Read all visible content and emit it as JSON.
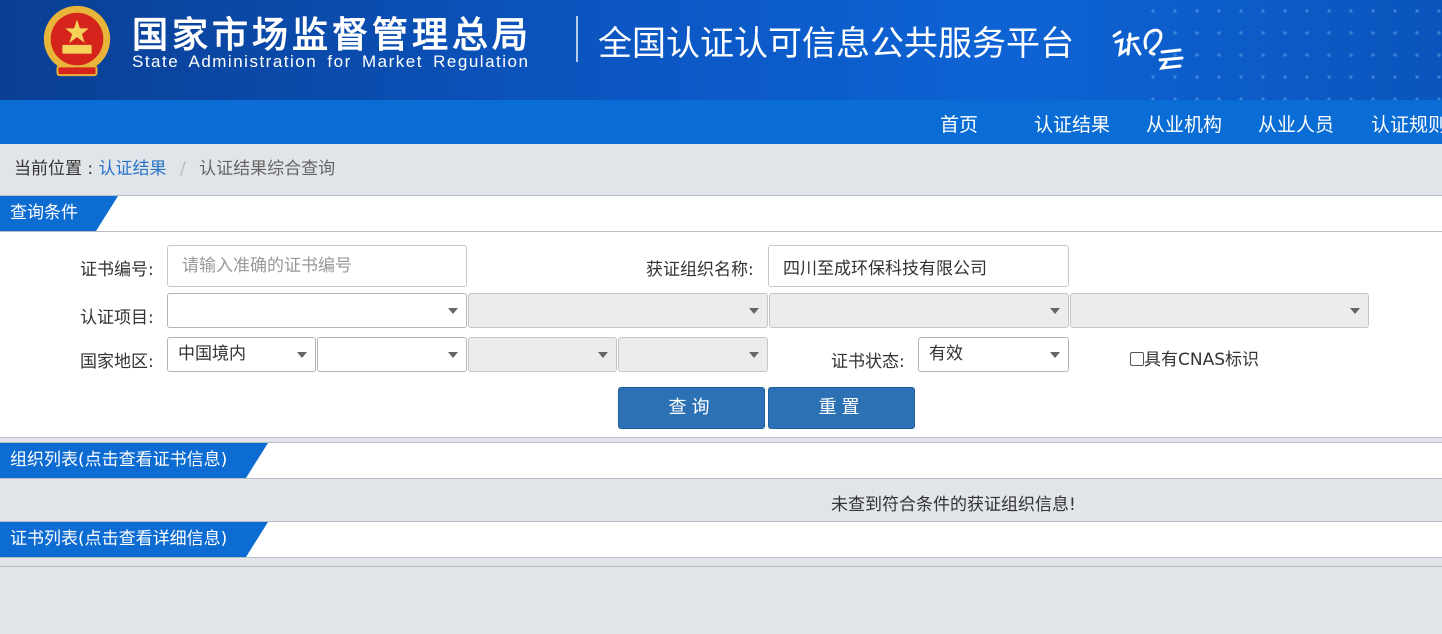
{
  "header": {
    "agency_cn": "国家市场监督管理总局",
    "agency_en": "State Administration  for  Market Regulation",
    "platform_title": "全国认证认可信息公共服务平台",
    "logo_icon": "renzheng-yun-logo",
    "emblem_icon": "national-emblem-icon"
  },
  "nav": {
    "items": [
      "首页",
      "认证结果",
      "从业机构",
      "从业人员",
      "认证规则"
    ]
  },
  "breadcrumb": {
    "prefix": "当前位置 :",
    "link": "认证结果",
    "separator": "/",
    "current": "认证结果综合查询"
  },
  "query_panel": {
    "title": "查询条件",
    "cert_no_label": "证书编号:",
    "cert_no_placeholder": "请输入准确的证书编号",
    "cert_no_value": "",
    "org_name_label": "获证组织名称:",
    "org_name_value": "四川至成环保科技有限公司",
    "project_label": "认证项目:",
    "project_selects": [
      "",
      "",
      "",
      ""
    ],
    "region_label": "国家地区:",
    "region_selects": [
      "中国境内",
      "",
      "",
      ""
    ],
    "status_label": "证书状态:",
    "status_value": "有效",
    "cnas_label": "具有CNAS标识",
    "cnas_checked": false,
    "search_button": "查询",
    "reset_button": "重置"
  },
  "org_panel": {
    "title": "组织列表(点击查看证书信息)",
    "empty_message": "未查到符合条件的获证组织信息!"
  },
  "cert_panel": {
    "title": "证书列表(点击查看详细信息)"
  },
  "colors": {
    "header_blue": "#0b57c4",
    "nav_blue": "#0a6dd5",
    "button_blue": "#2c71b3",
    "page_bg": "#e1e4e8"
  }
}
